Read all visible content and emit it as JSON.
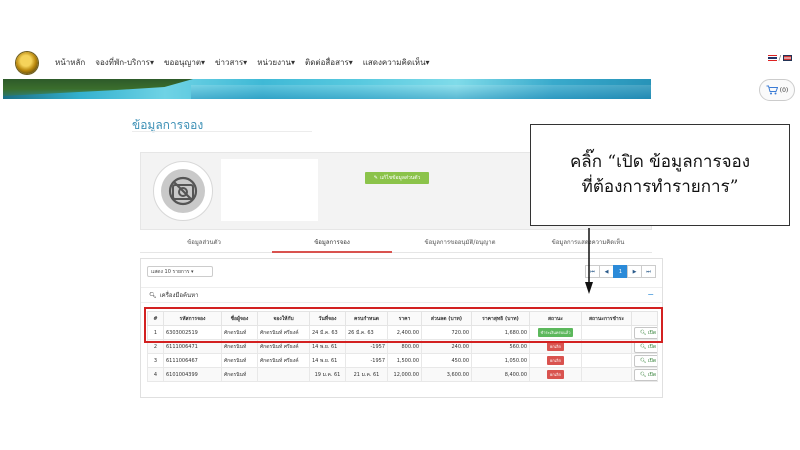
{
  "nav": {
    "items": [
      "หน้าหลัก",
      "จองที่พัก-บริการ▾",
      "ขออนุญาต▾",
      "ข่าวสาร▾",
      "หน่วยงาน▾",
      "ติดต่อสื่อสาร▾",
      "แสดงความคิดเห็น▾"
    ],
    "lang_sep": "/"
  },
  "cart": {
    "count": "(0)"
  },
  "page_title": "ข้อมูลการจอง",
  "profile": {
    "edit_button": "แก้ไขข้อมูลส่วนตัว"
  },
  "tabs": [
    "ข้อมูลส่วนตัว",
    "ข้อมูลการจอง",
    "ข้อมูลการขออนุมัติ/อนุญาต",
    "ข้อมูลการแสดงความคิดเห็น"
  ],
  "table_controls": {
    "length_select": "แสดง  10 รายการ",
    "pager": [
      "⏮",
      "◀",
      "1",
      "▶",
      "⏭"
    ],
    "tools_label": "เครื่องมือค้นหา",
    "collapse": "−"
  },
  "table": {
    "headers": [
      "#",
      "รหัสการจอง",
      "ชื่อผู้จอง",
      "จองให้กับ",
      "วันที่จอง",
      "ครบกำหนด",
      "ราคา",
      "ส่วนลด (บาท)",
      "ราคาสุทธิ (บาท)",
      "สถานะ",
      "สถานะการชำระ",
      ""
    ],
    "rows": [
      {
        "no": "1",
        "code": "6303002519",
        "name": "ศักดรนินท์",
        "for": "ศักดรนินท์ ศรีธงค์",
        "date": "24 มี.ค. 63",
        "due": "26 มี.ค. 63",
        "price": "2,400.00",
        "discount": "720.00",
        "net": "1,680.00",
        "status": "ชำระเงินครบแล้ว",
        "status_color": "green",
        "pay": "",
        "action": "เปิด"
      },
      {
        "no": "2",
        "code": "6111006471",
        "name": "ศักดรนินท์",
        "for": "ศักดรนินท์ ศรีธงค์",
        "date": "14 พ.ย. 61",
        "due": "-1957",
        "price": "800.00",
        "discount": "240.00",
        "net": "560.00",
        "status": "ยกเลิก",
        "status_color": "red",
        "pay": "",
        "action": "เปิด"
      },
      {
        "no": "3",
        "code": "6111006467",
        "name": "ศักดรนินท์",
        "for": "ศักดรนินท์ ศรีธงค์",
        "date": "14 พ.ย. 61",
        "due": "-1957",
        "price": "1,500.00",
        "discount": "450.00",
        "net": "1,050.00",
        "status": "ยกเลิก",
        "status_color": "red",
        "pay": "",
        "action": "เปิด"
      },
      {
        "no": "4",
        "code": "6101004399",
        "name": "ศักดรนินท์",
        "for": "",
        "date": "19 ม.ค. 61",
        "due": "21 ม.ค. 61",
        "price": "12,000.00",
        "discount": "3,600.00",
        "net": "8,400.00",
        "status": "ยกเลิก",
        "status_color": "red",
        "pay": "",
        "action": "เปิด"
      }
    ]
  },
  "callout": {
    "line1": "คลิ๊ก  “เปิด  ข้อมูลการจอง",
    "line2": "ที่ต้องการทำรายการ”"
  },
  "colors": {
    "accent": "#2b8ad8",
    "highlight": "#d32121",
    "edit": "#8bc34a",
    "title": "#3a8fb5"
  }
}
